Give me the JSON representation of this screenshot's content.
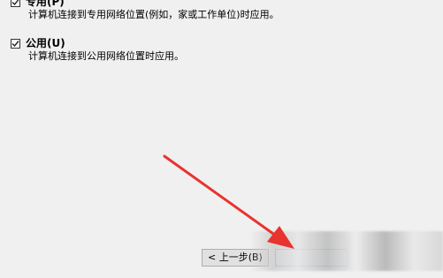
{
  "options": [
    {
      "id": "private",
      "label": "专用(P)",
      "checked": true,
      "description": "计算机连接到专用网络位置(例如，家或工作单位)时应用。"
    },
    {
      "id": "public",
      "label": "公用(U)",
      "checked": true,
      "description": "计算机连接到公用网络位置时应用。"
    }
  ],
  "buttons": {
    "back_label": "< 上一步(B)"
  },
  "colors": {
    "background": "#f0f0f0",
    "arrow": "#e8332f",
    "focus_border": "#0078d7"
  }
}
